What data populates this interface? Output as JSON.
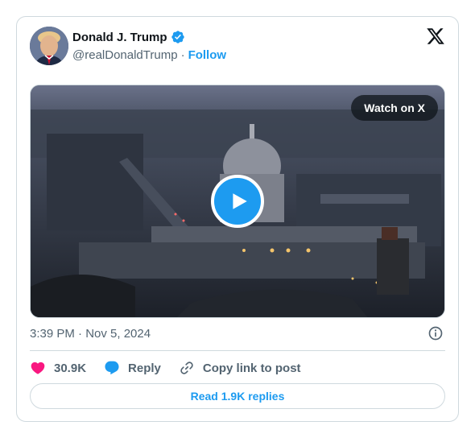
{
  "author": {
    "name": "Donald J. Trump",
    "handle": "@realDonaldTrump",
    "separator": "·",
    "follow_label": "Follow"
  },
  "media": {
    "watch_label": "Watch on X"
  },
  "meta": {
    "timestamp": "3:39 PM · Nov 5, 2024"
  },
  "actions": {
    "likes": "30.9K",
    "reply_label": "Reply",
    "copy_label": "Copy link to post"
  },
  "footer": {
    "read_replies_label": "Read 1.9K replies"
  },
  "colors": {
    "accent": "#1d9bf0",
    "like": "#f91880",
    "text_secondary": "#536471",
    "border": "#cfd9de"
  }
}
